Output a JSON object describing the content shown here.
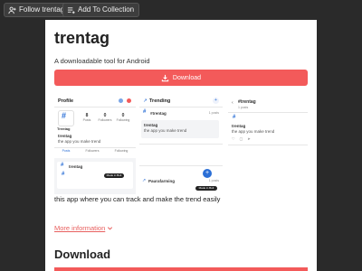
{
  "toolbar": {
    "follow_label": "Follow trentag",
    "collection_label": "Add To Collection"
  },
  "game": {
    "title": "trentag",
    "tagline": "A downloadable tool for Android",
    "download_label": "Download",
    "description": "this app where you can track and make the trend easily",
    "more_info_label": "More information",
    "download_heading": "Download"
  },
  "screenshots": {
    "profile": {
      "header": "Profile",
      "app_name": "Trentag",
      "stats": [
        {
          "value": "8",
          "label": "Posts"
        },
        {
          "value": "0",
          "label": "Followers"
        },
        {
          "value": "0",
          "label": "Following"
        }
      ],
      "handle": "trentag",
      "bio": "the app you make trend",
      "tabs": [
        "Posts",
        "Followers",
        "Following"
      ],
      "card_title": "trentag",
      "badge": "Made in Bolt"
    },
    "trending": {
      "header": "Trending",
      "items": [
        {
          "tag": "#trentag",
          "count": "1 posts"
        },
        {
          "tag": "trentag",
          "count": ""
        },
        {
          "tag": "Paurafarming",
          "count": "1 posts"
        }
      ],
      "post_text": "the app you make trend",
      "fab": "+",
      "badge": "Made in Bolt"
    },
    "post": {
      "tag": "#trentag",
      "count": "1 posts",
      "user": "trentag",
      "text": "the app you make trend"
    }
  },
  "colors": {
    "accent": "#f35a5a",
    "link": "#e8605f",
    "background": "#2a2a2a",
    "brand_blue": "#2b6fd6"
  }
}
